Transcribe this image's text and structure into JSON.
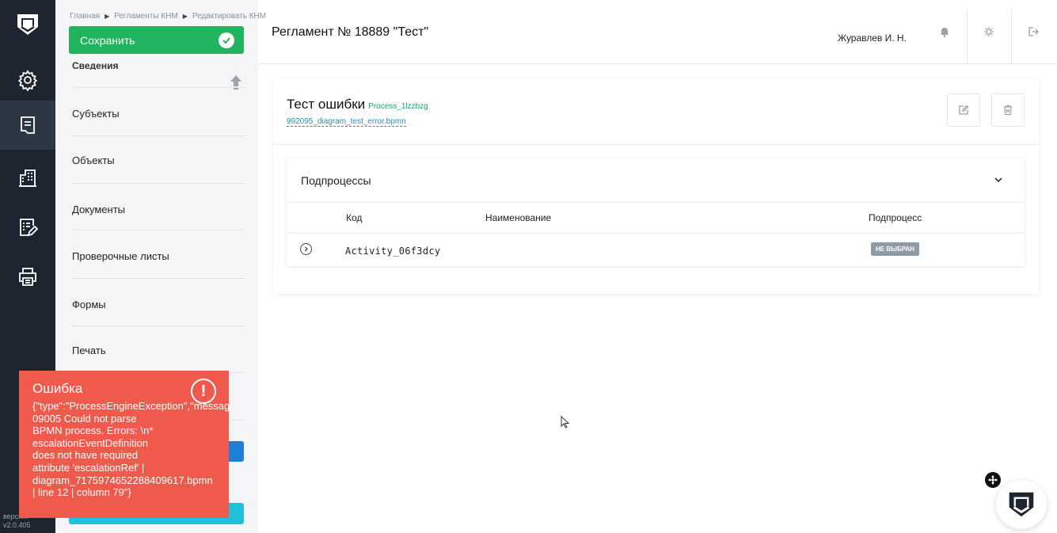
{
  "app": {
    "version_label": "версия:",
    "version_value": "v2.0.405"
  },
  "toolbar": {
    "save_label": "Сохранить"
  },
  "breadcrumb": {
    "items": [
      "Главная",
      "Регламенты КНМ",
      "Редактировать КНМ"
    ]
  },
  "header": {
    "title": "Регламент № 18889 \"Тест\"",
    "user_name": "Журавлев И. Н."
  },
  "sidebar": {
    "partial_item": "Сведения",
    "items": [
      {
        "label": "Субъекты"
      },
      {
        "label": "Объекты"
      },
      {
        "label": "Документы"
      },
      {
        "label": "Проверочные листы"
      },
      {
        "label": "Формы"
      },
      {
        "label": "Печать"
      }
    ]
  },
  "process": {
    "title": "Тест ошибки",
    "process_id": "Process_1lzzbzg",
    "file_name": "992095_diagram_test_error.bpmn"
  },
  "subprocesses": {
    "title": "Подпроцессы",
    "columns": [
      "Код",
      "Наименование",
      "Подпроцесс"
    ],
    "rows": [
      {
        "code": "Activity_06f3dcy",
        "name": "",
        "subprocess": "НЕ ВЫБРАН"
      }
    ]
  },
  "error": {
    "title": "Ошибка",
    "lines": [
      "{\"type\":\"ProcessEngineException\",\"message\":",
      "09005 Could not parse",
      "BPMN process. Errors: \\n*",
      "escalationEventDefinition",
      "does not have required",
      "attribute 'escalationRef' |",
      "diagram_7175974652288409617.bpmn",
      "| line 12 | column 79\"}"
    ]
  },
  "colors": {
    "rail": "#1d2530",
    "save_green": "#21b35d",
    "error_red": "#f05a4c",
    "link_teal": "#1f8fb7",
    "badge_gray": "#8d9ba6"
  },
  "icons": {
    "rail": [
      "logo-shield-icon",
      "gear-icon",
      "document-list-icon",
      "building-icon",
      "checklist-edit-icon",
      "printer-icon"
    ],
    "header": [
      "bell-icon",
      "settings-icon",
      "logout-icon"
    ],
    "card": [
      "edit-icon",
      "delete-icon"
    ]
  }
}
